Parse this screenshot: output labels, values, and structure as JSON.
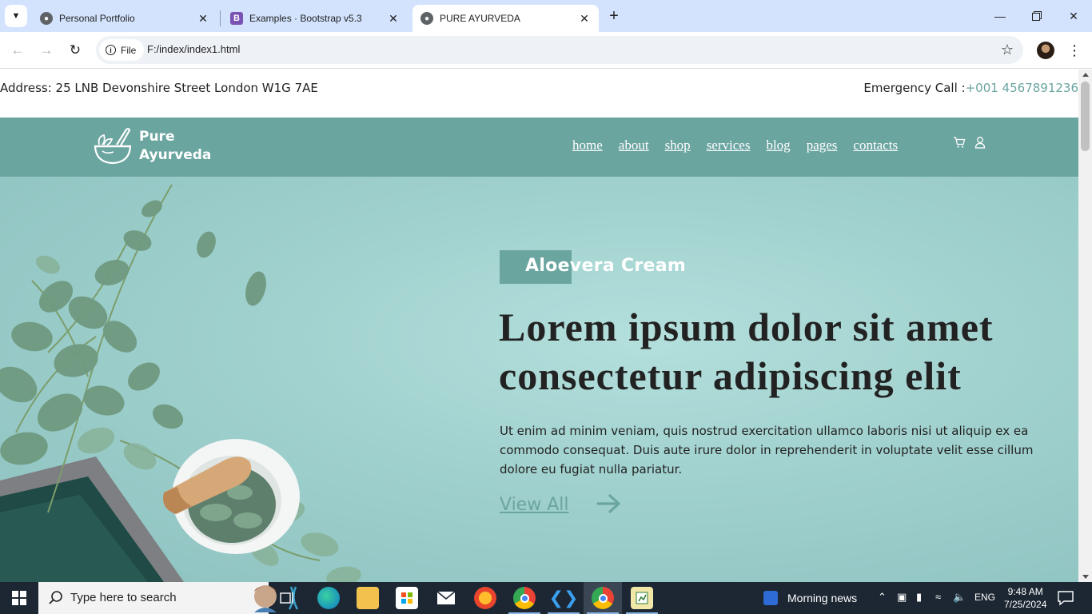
{
  "browser": {
    "tabs": [
      {
        "title": "Personal Portfolio",
        "icon": "globe-icon",
        "active": false
      },
      {
        "title": "Examples · Bootstrap v5.3",
        "icon": "bootstrap-icon",
        "active": false
      },
      {
        "title": "PURE AYURVEDA",
        "icon": "globe-icon",
        "active": true
      }
    ],
    "site_chip": "File",
    "url": "F:/index/index1.html"
  },
  "page": {
    "address": "Address: 25 LNB Devonshire Street London W1G 7AE",
    "emergency_label": "Emergency Call :",
    "emergency_phone": "+001 4567891236",
    "brand_line1": "Pure",
    "brand_line2": "Ayurveda",
    "nav": [
      "home",
      "about",
      "shop",
      "services",
      "blog",
      "pages",
      "contacts"
    ],
    "hero": {
      "badge": "Aloevera Cream",
      "title": "Lorem ipsum dolor sit amet consectetur adipiscing elit",
      "description": "Ut enim ad minim veniam, quis nostrud exercitation ullamco laboris nisi ut aliquip ex ea commodo consequat. Duis aute irure dolor in reprehenderit in voluptate velit esse cillum dolore eu fugiat nulla pariatur.",
      "cta": "View All"
    },
    "colors": {
      "accent": "#6ba5a0",
      "hero_bg": "#a6d6d3",
      "text": "#222222"
    }
  },
  "taskbar": {
    "search_placeholder": "Type here to search",
    "news": "Morning news",
    "language": "ENG",
    "time": "9:48 AM",
    "date": "7/25/2024"
  }
}
